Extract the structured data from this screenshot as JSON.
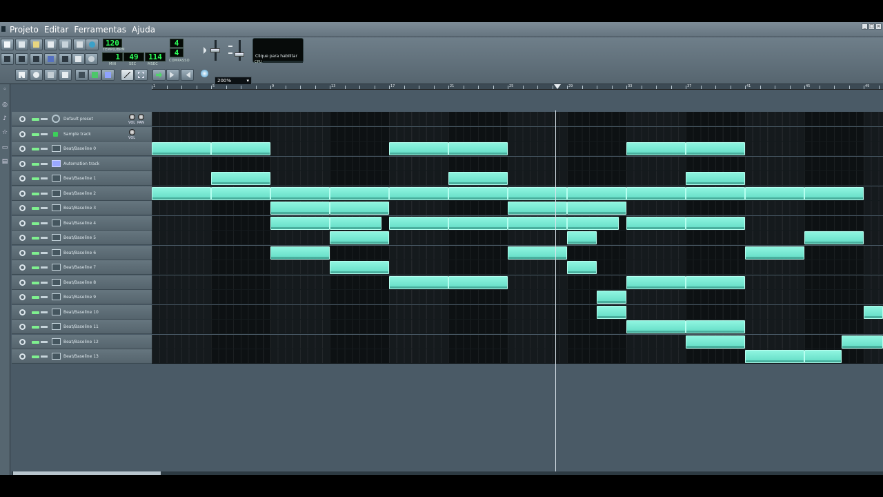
{
  "menu": {
    "items": [
      "Projeto",
      "Editar",
      "Ferramentas",
      "Ajuda"
    ]
  },
  "window_controls": [
    "_",
    "□",
    "×"
  ],
  "transport": {
    "tempo": "120",
    "tempo_label": "TEMPO/BPM",
    "time_min": "1",
    "time_sec": "49",
    "time_msec": "114",
    "time_min_label": "MIN",
    "time_sec_label": "SEC",
    "time_msec_label": "MSEC",
    "time_sig_num": "4",
    "time_sig_den": "4",
    "time_sig_label": "COMPASSO",
    "cpu_hint": "Clique para habilitar",
    "cpu_label": "CPU",
    "zoom": "200%"
  },
  "timeline": {
    "bars": [
      "1",
      "5",
      "9",
      "13",
      "17",
      "21",
      "25",
      "29",
      "33",
      "37",
      "41",
      "45",
      "49"
    ]
  },
  "tracks": [
    {
      "name": "Default preset",
      "type": "instrument",
      "clips": [],
      "knobs": [
        "VOL",
        "PAN"
      ]
    },
    {
      "name": "Sample track",
      "type": "sample",
      "clips": [],
      "knobs": [
        "VOL"
      ]
    },
    {
      "name": "Beat/Baseline 0",
      "type": "beat",
      "clips": [
        [
          0,
          4
        ],
        [
          4,
          4
        ],
        [
          16,
          4
        ],
        [
          20,
          4
        ],
        [
          32,
          4
        ],
        [
          36,
          4
        ]
      ]
    },
    {
      "name": "Automation track",
      "type": "automation",
      "clips": []
    },
    {
      "name": "Beat/Baseline 1",
      "type": "beat",
      "clips": [
        [
          4,
          4
        ],
        [
          20,
          4
        ],
        [
          36,
          4
        ]
      ]
    },
    {
      "name": "Beat/Baseline 2",
      "type": "beat",
      "clips": [
        [
          0,
          4
        ],
        [
          4,
          4
        ],
        [
          8,
          4
        ],
        [
          12,
          4
        ],
        [
          16,
          4
        ],
        [
          20,
          4
        ],
        [
          24,
          4
        ],
        [
          28,
          4
        ],
        [
          32,
          4
        ],
        [
          36,
          4
        ],
        [
          40,
          4
        ],
        [
          44,
          4
        ]
      ]
    },
    {
      "name": "Beat/Baseline 3",
      "type": "beat",
      "clips": [
        [
          8,
          4
        ],
        [
          12,
          4
        ],
        [
          24,
          4
        ],
        [
          28,
          4
        ]
      ]
    },
    {
      "name": "Beat/Baseline 4",
      "type": "beat",
      "clips": [
        [
          8,
          4
        ],
        [
          12,
          3.5
        ],
        [
          16,
          4
        ],
        [
          20,
          4
        ],
        [
          24,
          4
        ],
        [
          28,
          3.5
        ],
        [
          32,
          4
        ],
        [
          36,
          4
        ]
      ]
    },
    {
      "name": "Beat/Baseline 5",
      "type": "beat",
      "clips": [
        [
          12,
          4
        ],
        [
          28,
          2
        ],
        [
          44,
          4
        ]
      ]
    },
    {
      "name": "Beat/Baseline 6",
      "type": "beat",
      "clips": [
        [
          8,
          4
        ],
        [
          24,
          4
        ],
        [
          40,
          4
        ]
      ]
    },
    {
      "name": "Beat/Baseline 7",
      "type": "beat",
      "clips": [
        [
          12,
          4
        ],
        [
          28,
          2
        ]
      ]
    },
    {
      "name": "Beat/Baseline 8",
      "type": "beat",
      "clips": [
        [
          16,
          4
        ],
        [
          20,
          4
        ],
        [
          32,
          4
        ],
        [
          36,
          4
        ]
      ]
    },
    {
      "name": "Beat/Baseline 9",
      "type": "beat",
      "clips": [
        [
          30,
          2
        ]
      ]
    },
    {
      "name": "Beat/Baseline 10",
      "type": "beat",
      "clips": [
        [
          30,
          2
        ],
        [
          48,
          1.3
        ]
      ]
    },
    {
      "name": "Beat/Baseline 11",
      "type": "beat",
      "clips": [
        [
          32,
          4
        ],
        [
          36,
          4
        ]
      ]
    },
    {
      "name": "Beat/Baseline 12",
      "type": "beat",
      "clips": [
        [
          36,
          4
        ],
        [
          46.5,
          2.8
        ]
      ]
    },
    {
      "name": "Beat/Baseline 13",
      "type": "beat",
      "clips": [
        [
          40,
          4
        ],
        [
          44,
          2.5
        ]
      ]
    }
  ],
  "colors": {
    "clip": "#7eeed8",
    "lane_bg": "#0c0f11",
    "panel": "#4a5a66",
    "lcd_text": "#2dff5a"
  }
}
